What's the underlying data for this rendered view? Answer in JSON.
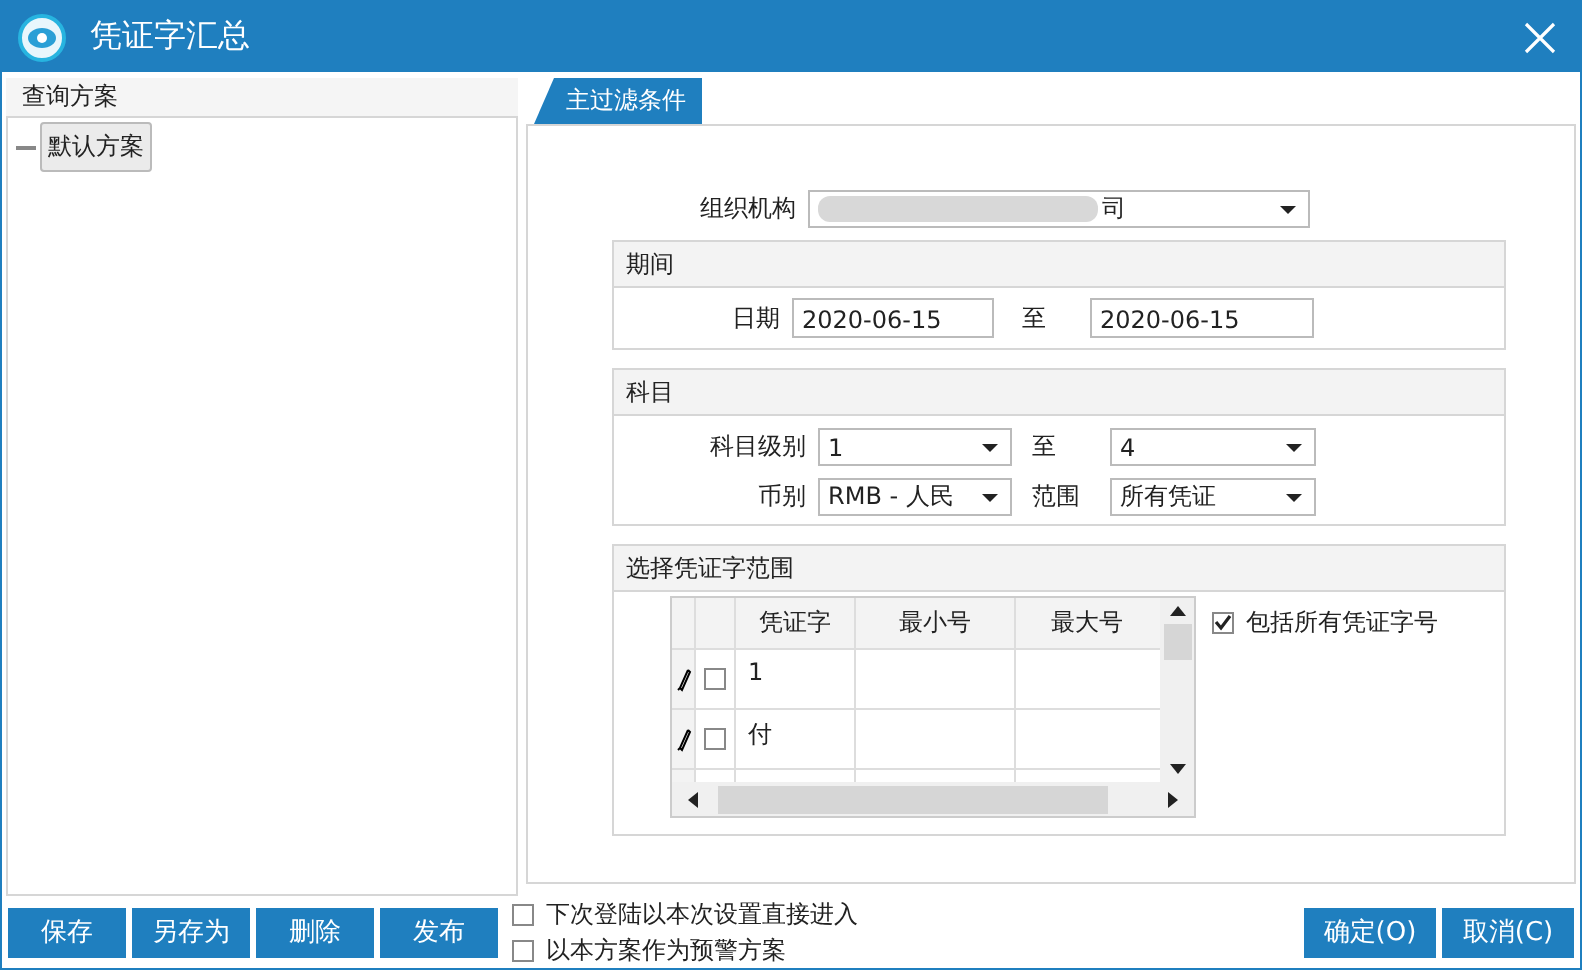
{
  "window": {
    "title": "凭证字汇总"
  },
  "sidebar": {
    "title": "查询方案",
    "tree": [
      {
        "label": "默认方案",
        "selected": true
      }
    ]
  },
  "tabs": [
    {
      "label": "主过滤条件",
      "selected": true
    }
  ],
  "filter": {
    "org": {
      "label": "组织机构",
      "value": "司"
    },
    "period": {
      "title": "期间",
      "date_label": "日期",
      "from": "2020-06-15",
      "to_label": "至",
      "to": "2020-06-15"
    },
    "account": {
      "title": "科目",
      "level_label": "科目级别",
      "level_from": "1",
      "to_label": "至",
      "level_to": "4",
      "currency_label": "币别",
      "currency": "RMB - 人民",
      "scope_label": "范围",
      "scope": "所有凭证"
    },
    "voucher": {
      "title": "选择凭证字范围",
      "columns": [
        "凭证字",
        "最小号",
        "最大号"
      ],
      "rows": [
        {
          "word": "1",
          "checked": false
        },
        {
          "word": "付",
          "checked": false
        }
      ],
      "include_all": {
        "label": "包括所有凭证字号",
        "checked": true
      }
    }
  },
  "footer": {
    "buttons": [
      "保存",
      "另存为",
      "删除",
      "发布"
    ],
    "options": [
      {
        "label": "下次登陆以本次设置直接进入",
        "checked": false
      },
      {
        "label": "以本方案作为预警方案",
        "checked": false
      }
    ],
    "actions": [
      "确定(O)",
      "取消(C)"
    ]
  }
}
